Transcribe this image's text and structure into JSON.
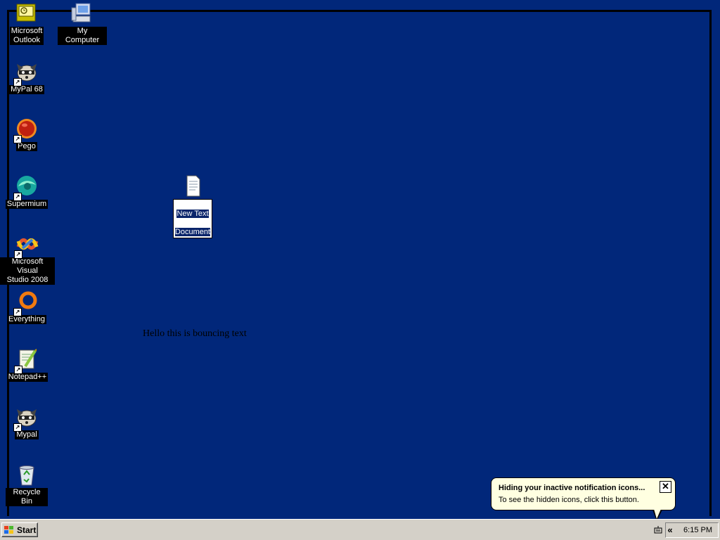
{
  "desktop": {
    "background_color": "#01277a",
    "icons": [
      {
        "label": "Microsoft\nOutlook",
        "icon": "outlook-icon"
      },
      {
        "label": "My Computer",
        "icon": "my-computer-icon"
      },
      {
        "label": "MyPal 68",
        "icon": "raccoon-icon"
      },
      {
        "label": "Pego",
        "icon": "pego-icon"
      },
      {
        "label": "Supermium",
        "icon": "supermium-icon"
      },
      {
        "label": "Microsoft Visual\nStudio 2008",
        "icon": "visual-studio-icon"
      },
      {
        "label": "Everything",
        "icon": "everything-icon"
      },
      {
        "label": "Notepad++",
        "icon": "notepad-plus-plus-icon"
      },
      {
        "label": "Mypal",
        "icon": "raccoon-icon"
      },
      {
        "label": "Recycle Bin",
        "icon": "recycle-bin-icon"
      }
    ],
    "new_text_document": {
      "label_line1": "New Text",
      "label_line2": "Document"
    },
    "bouncing_text": "Hello this is bouncing text"
  },
  "taskbar": {
    "start_label": "Start",
    "show_hidden_icons": "«",
    "clock": "6:15 PM"
  },
  "balloon": {
    "title": "Hiding your inactive notification icons...",
    "text": "To see the hidden icons, click this button.",
    "close": "✕"
  }
}
